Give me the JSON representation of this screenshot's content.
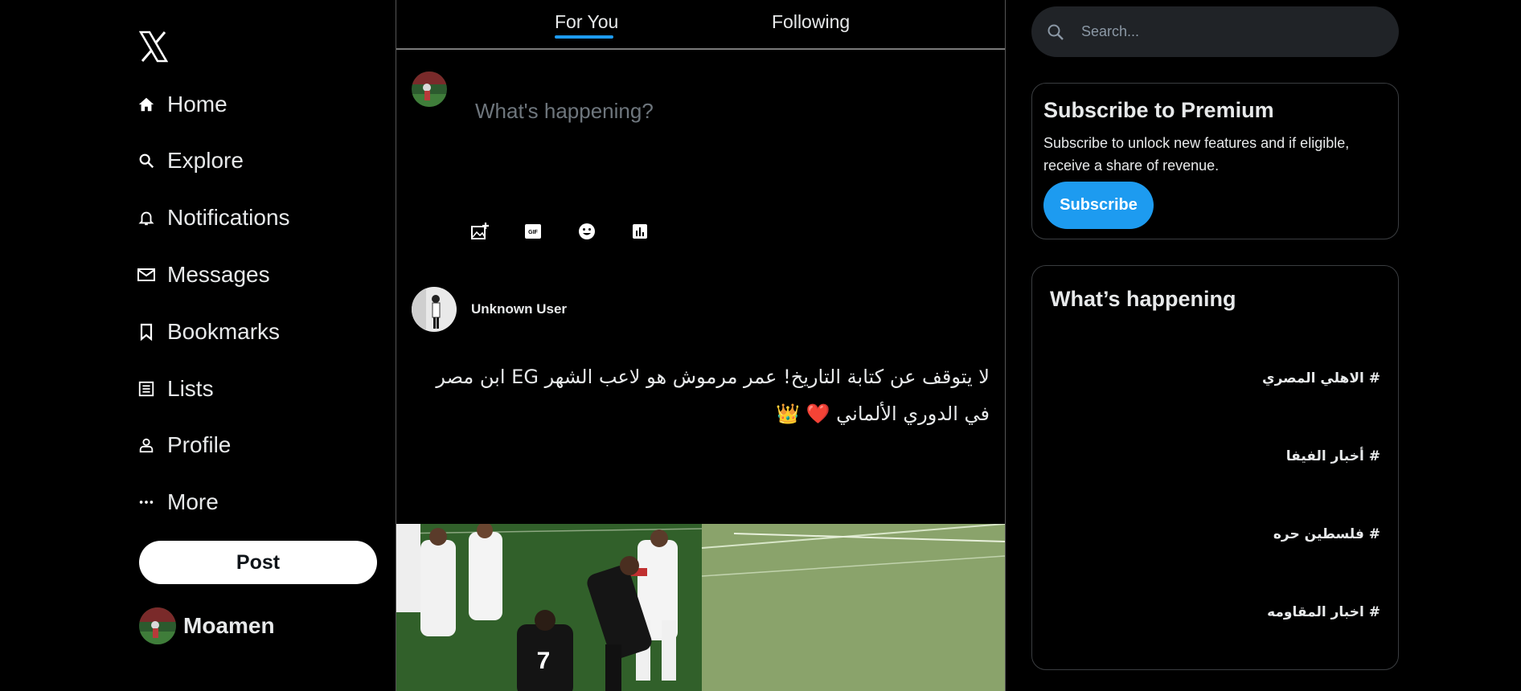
{
  "nav": {
    "items": [
      {
        "label": "Home",
        "icon": "home-icon"
      },
      {
        "label": "Explore",
        "icon": "search-icon"
      },
      {
        "label": "Notifications",
        "icon": "bell-icon"
      },
      {
        "label": "Messages",
        "icon": "mail-icon"
      },
      {
        "label": "Bookmarks",
        "icon": "bookmark-icon"
      },
      {
        "label": "Lists",
        "icon": "list-icon"
      },
      {
        "label": "Profile",
        "icon": "person-icon"
      },
      {
        "label": "More",
        "icon": "more-icon"
      }
    ],
    "post_label": "Post",
    "account_name": "Moamen"
  },
  "feed": {
    "tabs": [
      {
        "label": "For You",
        "active": true
      },
      {
        "label": "Following",
        "active": false
      }
    ],
    "compose_placeholder": "What's happening?",
    "tools": [
      "image-add-icon",
      "gif-icon",
      "emoji-icon",
      "poll-icon"
    ],
    "post": {
      "user": "Unknown User",
      "text_line1": "لا يتوقف عن كتابة التاريخ! عمر مرموش هو لاعب الشهر EG ابن مصر",
      "text_line2": "في الدوري الألماني ❤️ 👑"
    }
  },
  "right": {
    "search_placeholder": "Search...",
    "premium": {
      "title": "Subscribe to Premium",
      "description": "Subscribe to unlock new features and if eligible, receive a share of revenue.",
      "button": "Subscribe"
    },
    "happening": {
      "title": "What’s happening",
      "trends": [
        "# الاهلي المصري",
        "# أخبار الفيفا",
        "# فلسطين حره",
        "# اخبار المقاومه"
      ]
    }
  },
  "colors": {
    "accent": "#1d9bf0",
    "background": "#000000",
    "text": "#e7e9ea",
    "border": "#3a3d40"
  }
}
